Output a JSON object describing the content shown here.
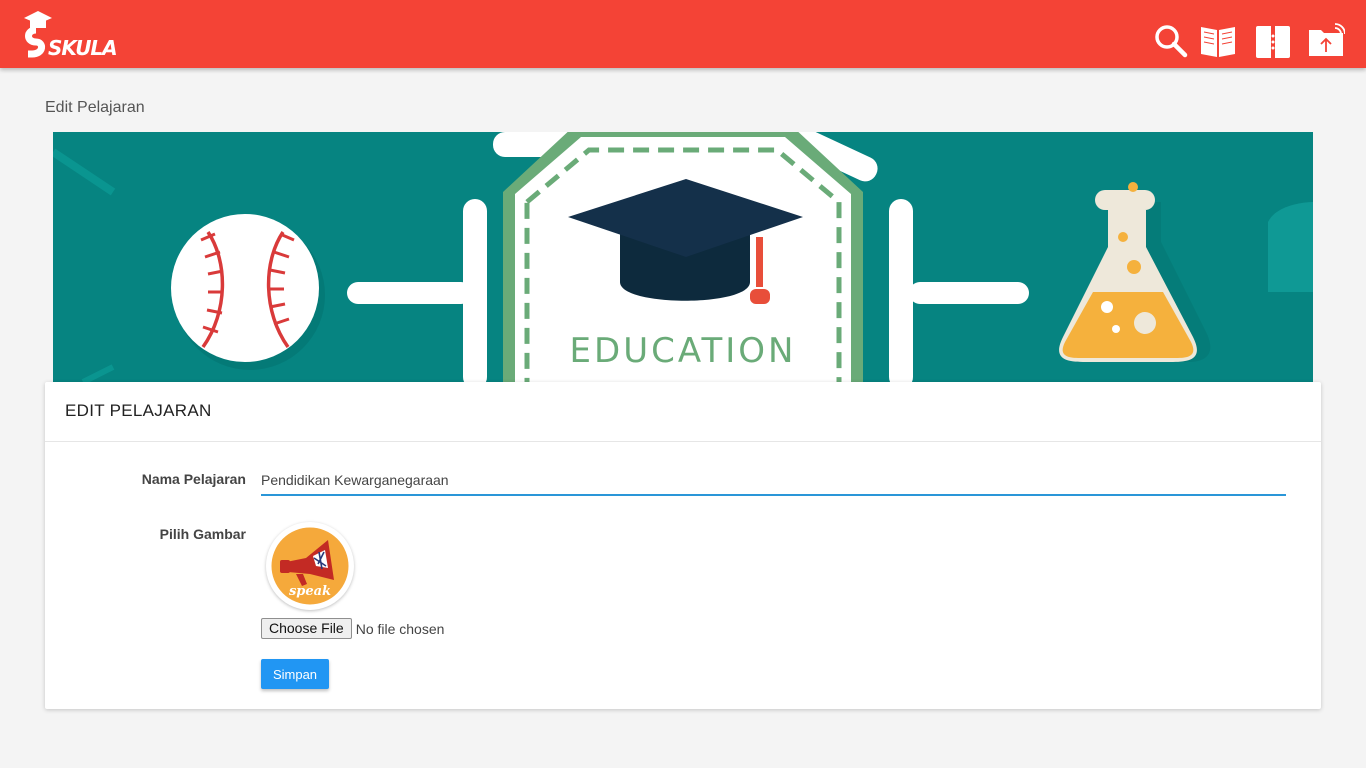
{
  "app": {
    "logo_text": "SKULA",
    "brand_color": "#f44336"
  },
  "topbar": {
    "icons": [
      "search-icon",
      "book-open-icon",
      "notebook-icon",
      "folder-upload-icon"
    ]
  },
  "page": {
    "title": "Edit Pelajaran"
  },
  "banner": {
    "text": "EDUCATION"
  },
  "form": {
    "header": "EDIT PELAJARAN",
    "name_label": "Nama Pelajaran",
    "name_value": "Pendidikan Kewarganegaraan",
    "image_label": "Pilih Gambar",
    "image_caption": "speak",
    "file_button": "Choose File",
    "file_status": "No file chosen",
    "save_label": "Simpan",
    "accent_color": "#2196f3"
  }
}
